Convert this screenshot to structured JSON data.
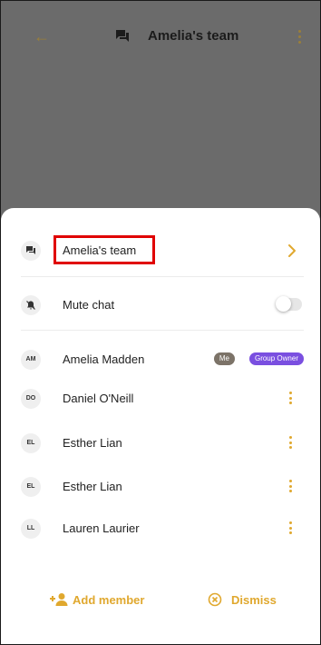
{
  "header": {
    "title": "Amelia's team"
  },
  "sheet": {
    "chat_name": "Amelia's team",
    "mute_label": "Mute chat",
    "members": [
      {
        "initials": "AM",
        "name": "Amelia Madden",
        "badges": [
          "Me",
          "Group Owner"
        ]
      },
      {
        "initials": "DO",
        "name": "Daniel O'Neill"
      },
      {
        "initials": "EL",
        "name": "Esther Lian"
      },
      {
        "initials": "EL",
        "name": "Esther Lian"
      },
      {
        "initials": "LL",
        "name": "Lauren Laurier"
      }
    ]
  },
  "footer": {
    "add_member_label": "Add member",
    "dismiss_label": "Dismiss"
  },
  "colors": {
    "accent": "#e0a82e",
    "owner_badge": "#7a4fe0",
    "me_badge": "#7c7368",
    "highlight": "#e00000"
  }
}
